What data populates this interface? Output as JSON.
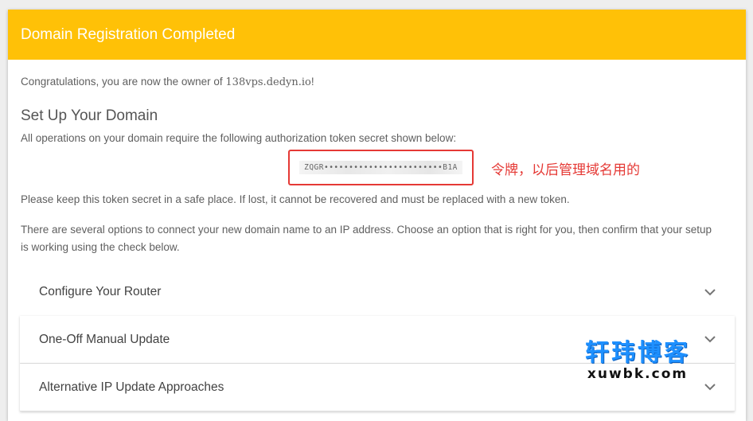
{
  "header": {
    "title": "Domain Registration Completed"
  },
  "intro": {
    "prefix": "Congratulations, you are now the owner of ",
    "domain": "138vps.dedyn.io",
    "suffix": "!"
  },
  "setup": {
    "title": "Set Up Your Domain",
    "token_description": "All operations on your domain require the following authorization token secret shown below:",
    "token_value": "ZQGR••••••••••••••••••••••••B1A",
    "token_annotation": "令牌，以后管理域名用的",
    "keep_secret": "Please keep this token secret in a safe place. If lost, it cannot be recovered and must be replaced with a new token.",
    "options_text": "There are several options to connect your new domain name to an IP address. Choose an option that is right for you, then confirm that your setup is working using the check below."
  },
  "accordion": {
    "items": [
      {
        "label": "Configure Your Router"
      },
      {
        "label": "One-Off Manual Update"
      },
      {
        "label": "Alternative IP Update Approaches"
      }
    ],
    "icon": "chevron-down-icon"
  },
  "watermark": {
    "cn": "轩玮博客",
    "en": "xuwbk.com"
  },
  "colors": {
    "header": "#ffc107",
    "highlight": "#e53935",
    "watermark": "#1e90ff"
  }
}
